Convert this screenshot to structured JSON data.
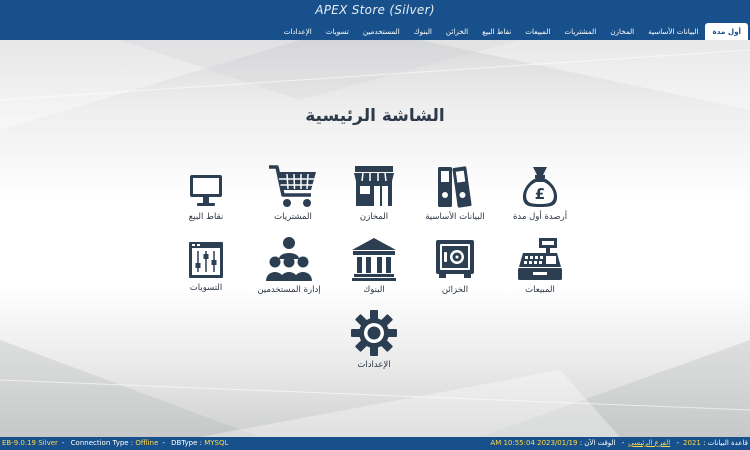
{
  "window": {
    "title": "APEX Store (Silver)"
  },
  "menu": {
    "items": [
      {
        "label": "أول مدة",
        "active": true
      },
      {
        "label": "البيانات الأساسية",
        "active": false
      },
      {
        "label": "المخازن",
        "active": false
      },
      {
        "label": "المشتريات",
        "active": false
      },
      {
        "label": "المبيعات",
        "active": false
      },
      {
        "label": "نقاط البيع",
        "active": false
      },
      {
        "label": "الخزائن",
        "active": false
      },
      {
        "label": "البنوك",
        "active": false
      },
      {
        "label": "المستخدمين",
        "active": false
      },
      {
        "label": "تسويات",
        "active": false
      },
      {
        "label": "الإعدادات",
        "active": false
      }
    ]
  },
  "main": {
    "title": "الشاشة الرئيسية",
    "tiles": [
      {
        "label": "أرصدة أول مدة",
        "icon": "money-bag-icon"
      },
      {
        "label": "البيانات الأساسية",
        "icon": "binders-icon"
      },
      {
        "label": "المخازن",
        "icon": "store-icon"
      },
      {
        "label": "المشتريات",
        "icon": "shopping-cart-icon"
      },
      {
        "label": "نقاط البيع",
        "icon": "monitor-icon"
      },
      {
        "label": "المبيعات",
        "icon": "cash-register-icon"
      },
      {
        "label": "الخزائن",
        "icon": "safe-icon"
      },
      {
        "label": "البنوك",
        "icon": "bank-icon"
      },
      {
        "label": "إدارة المستخدمين",
        "icon": "users-icon"
      },
      {
        "label": "التسويات",
        "icon": "sliders-icon"
      },
      {
        "label": "الإعدادات",
        "icon": "gear-icon"
      }
    ]
  },
  "status": {
    "version": "EB-9.0.19 Silver",
    "connection_label": "Connection Type :",
    "connection_value": "Offline",
    "dbtype_label": "DBType :",
    "dbtype_value": "MYSQL",
    "db_label": "قاعدة البيانات :",
    "db_value": "2021",
    "branch_value": "الفرع الرئيسي",
    "time_label": "الوقت الآن :",
    "time_value": "AM 10:55:04 2023/01/19"
  },
  "colors": {
    "bar": "#17508a",
    "icon": "#2b3e52",
    "status_highlight": "#ffd84a"
  }
}
